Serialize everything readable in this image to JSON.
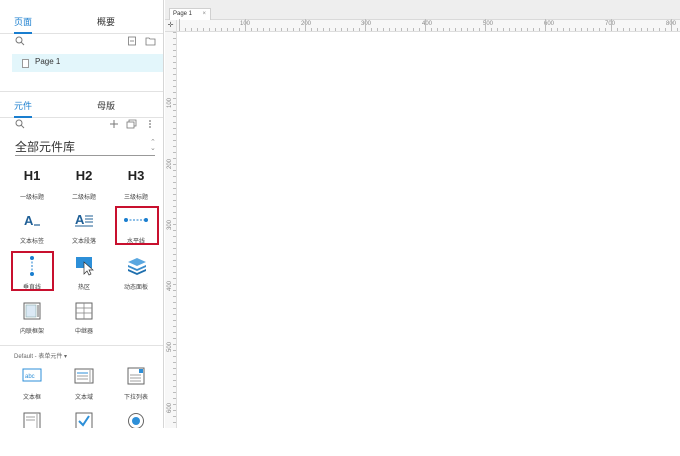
{
  "pages_panel": {
    "tabs": [
      "页面",
      "概要"
    ],
    "active_tab": "页面",
    "pages": [
      {
        "label": "Page 1"
      }
    ]
  },
  "library_panel": {
    "tabs": [
      "元件",
      "母版"
    ],
    "active_tab": "元件",
    "library_name": "全部元件库",
    "widgets": [
      {
        "label": "一级标题",
        "heading": "H1"
      },
      {
        "label": "二级标题",
        "heading": "H2"
      },
      {
        "label": "三级标题",
        "heading": "H3"
      },
      {
        "label": "文本标签"
      },
      {
        "label": "文本段落"
      },
      {
        "label": "水平线",
        "highlighted": true
      },
      {
        "label": "垂直线",
        "highlighted": true
      },
      {
        "label": "热区"
      },
      {
        "label": "动态面板"
      },
      {
        "label": "内联框架"
      },
      {
        "label": "中继器"
      }
    ],
    "form_section_label": "Default - 表单元件 ▾",
    "form_widgets": [
      {
        "label": "文本框"
      },
      {
        "label": "文本域"
      },
      {
        "label": "下拉列表"
      }
    ]
  },
  "canvas": {
    "tab_label": "Page 1",
    "ruler_h_labels": [
      "100",
      "200",
      "300",
      "400",
      "500",
      "600",
      "700",
      "800"
    ],
    "ruler_v_labels": [
      "100",
      "200",
      "300",
      "400",
      "500",
      "600"
    ]
  },
  "colors": {
    "accent": "#1a7ecf",
    "highlight": "#c8102e",
    "selected_page_bg": "#e3f6fb"
  }
}
